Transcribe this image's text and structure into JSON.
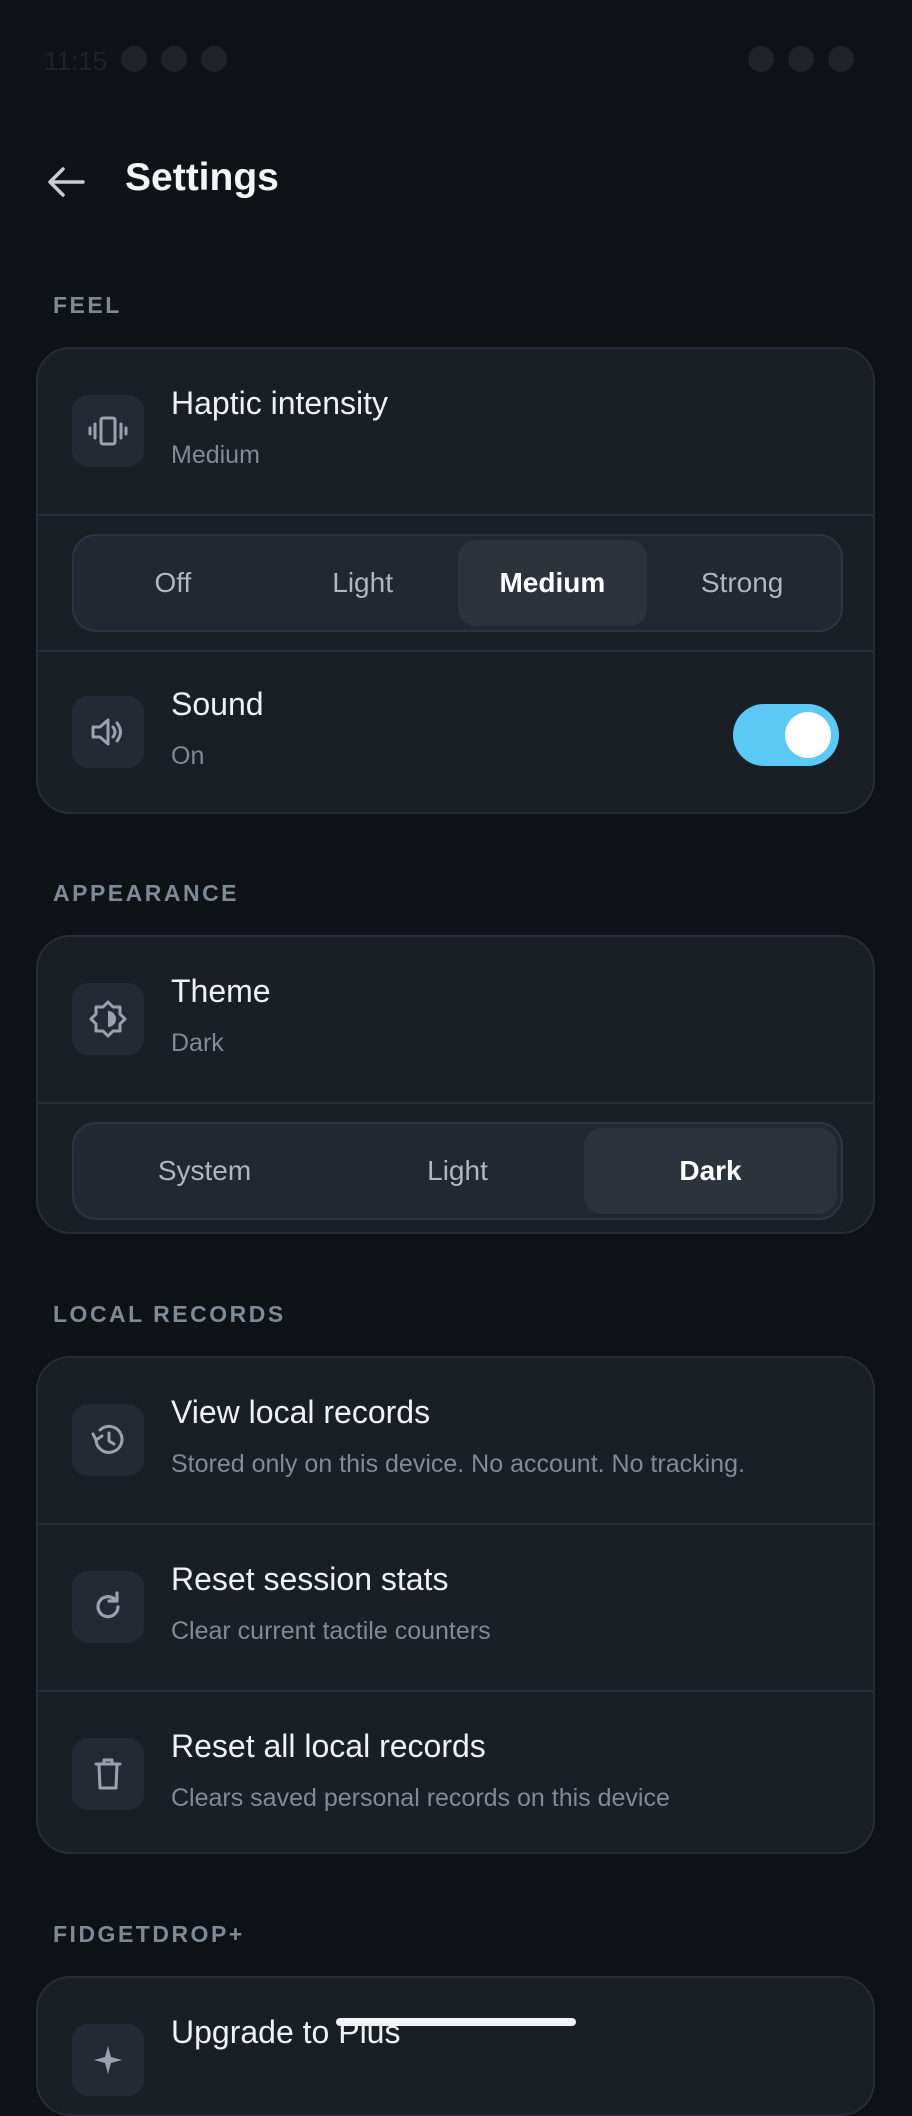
{
  "status_bar": {
    "time": "11:15"
  },
  "app_bar": {
    "title": "Settings",
    "back_icon": "arrow-left-icon"
  },
  "sections": {
    "feel": {
      "label": "FEEL",
      "haptic": {
        "title": "Haptic intensity",
        "value": "Medium",
        "icon": "vibration-icon",
        "options": [
          "Off",
          "Light",
          "Medium",
          "Strong"
        ],
        "selected": "Medium"
      },
      "sound": {
        "title": "Sound",
        "value": "On",
        "icon": "speaker-icon",
        "enabled": true
      }
    },
    "appearance": {
      "label": "APPEARANCE",
      "theme": {
        "title": "Theme",
        "value": "Dark",
        "icon": "brightness-icon",
        "options": [
          "System",
          "Light",
          "Dark"
        ],
        "selected": "Dark"
      }
    },
    "local_records": {
      "label": "LOCAL RECORDS",
      "items": [
        {
          "title": "View local records",
          "subtitle": "Stored only on this device. No account. No tracking.",
          "icon": "history-icon"
        },
        {
          "title": "Reset session stats",
          "subtitle": "Clear current tactile counters",
          "icon": "refresh-icon"
        },
        {
          "title": "Reset all local records",
          "subtitle": "Clears saved personal records on this device",
          "icon": "trash-icon"
        }
      ]
    },
    "plus": {
      "label": "FIDGETDROP+",
      "upgrade": {
        "title": "Upgrade to Plus",
        "icon": "sparkle-icon"
      }
    }
  },
  "colors": {
    "background": "#0f1216",
    "card": "#1a1f26",
    "accent": "#5cc8f5",
    "section_label": "#808a96"
  }
}
